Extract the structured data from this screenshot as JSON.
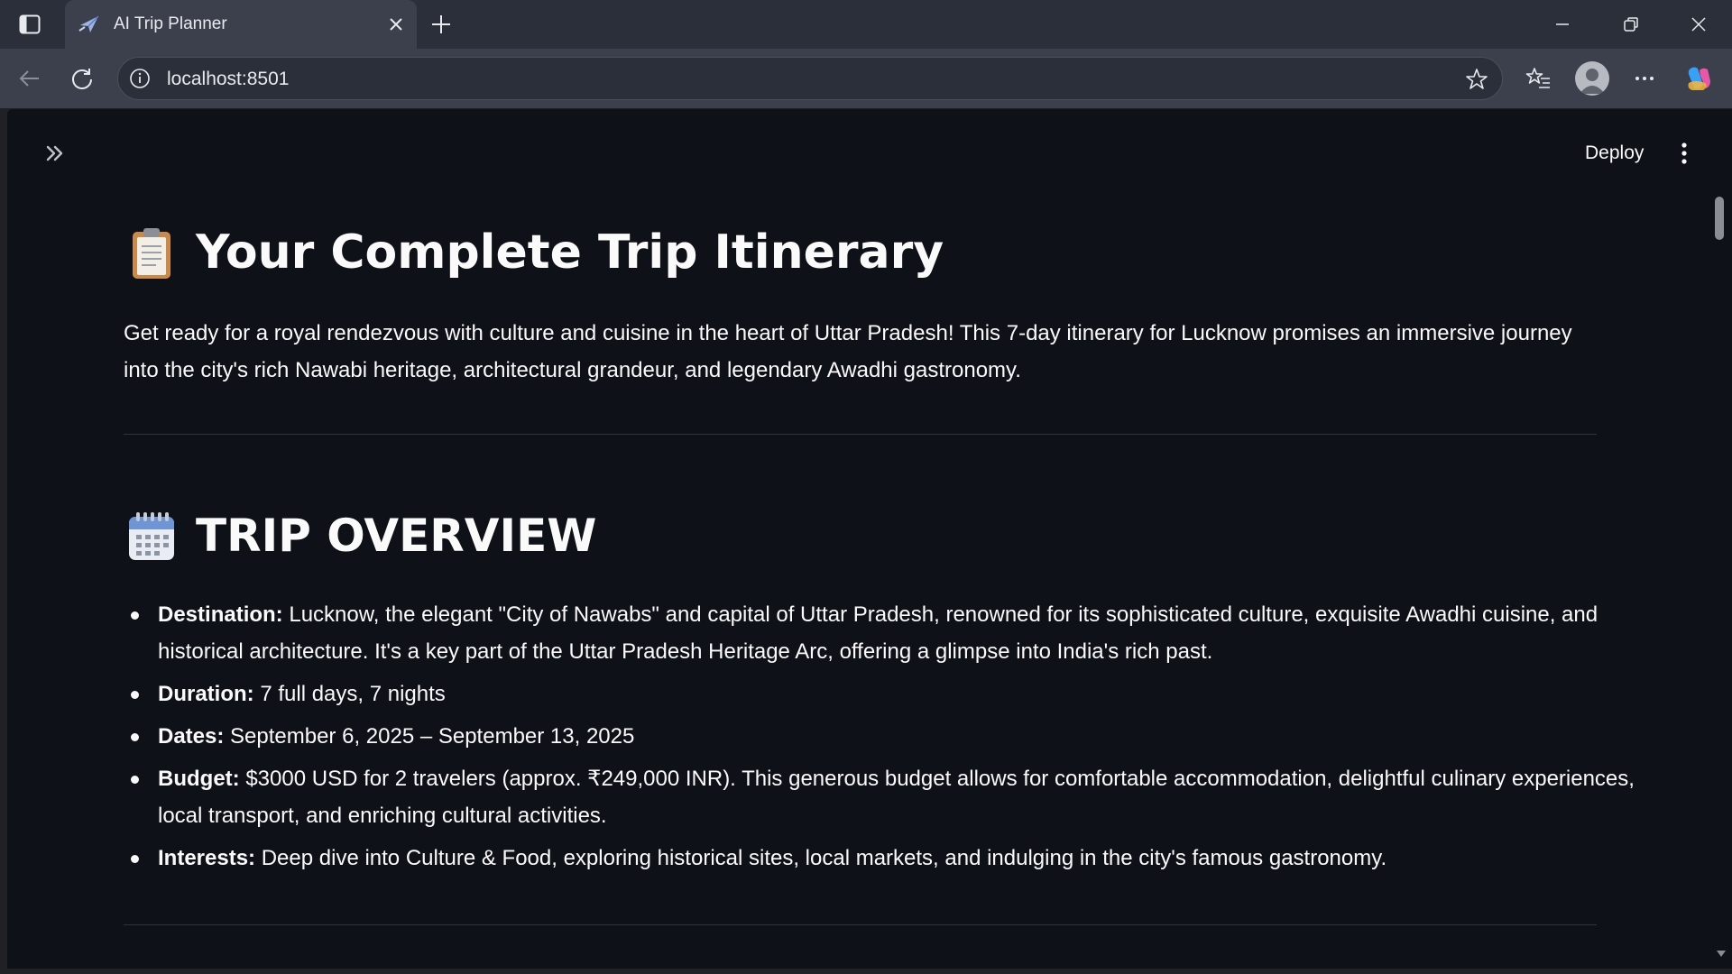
{
  "browser": {
    "tab_title": "AI Trip Planner",
    "url": "localhost:8501"
  },
  "app": {
    "deploy_label": "Deploy"
  },
  "page": {
    "title": "Your Complete Trip Itinerary",
    "intro": "Get ready for a royal rendezvous with culture and cuisine in the heart of Uttar Pradesh! This 7-day itinerary for Lucknow promises an immersive journey into the city's rich Nawabi heritage, architectural grandeur, and legendary Awadhi gastronomy.",
    "overview": {
      "heading": "TRIP OVERVIEW",
      "items": [
        {
          "label": "Destination:",
          "text": " Lucknow, the elegant \"City of Nawabs\" and capital of Uttar Pradesh, renowned for its sophisticated culture, exquisite Awadhi cuisine, and historical architecture. It's a key part of the Uttar Pradesh Heritage Arc, offering a glimpse into India's rich past."
        },
        {
          "label": "Duration:",
          "text": " 7 full days, 7 nights"
        },
        {
          "label": "Dates:",
          "text": " September 6, 2025 – September 13, 2025"
        },
        {
          "label": "Budget:",
          "text": " $3000 USD for 2 travelers (approx. ₹249,000 INR). This generous budget allows for comfortable accommodation, delightful culinary experiences, local transport, and enriching cultural activities."
        },
        {
          "label": "Interests:",
          "text": " Deep dive into Culture & Food, exploring historical sites, local markets, and indulging in the city's famous gastronomy."
        }
      ]
    }
  },
  "icons": {
    "title_emoji": "clipboard-icon",
    "overview_emoji": "calendar-icon"
  },
  "colors": {
    "app_background": "#0e1117",
    "text": "#fafafa",
    "browser_chrome": "#2b2f3a"
  }
}
